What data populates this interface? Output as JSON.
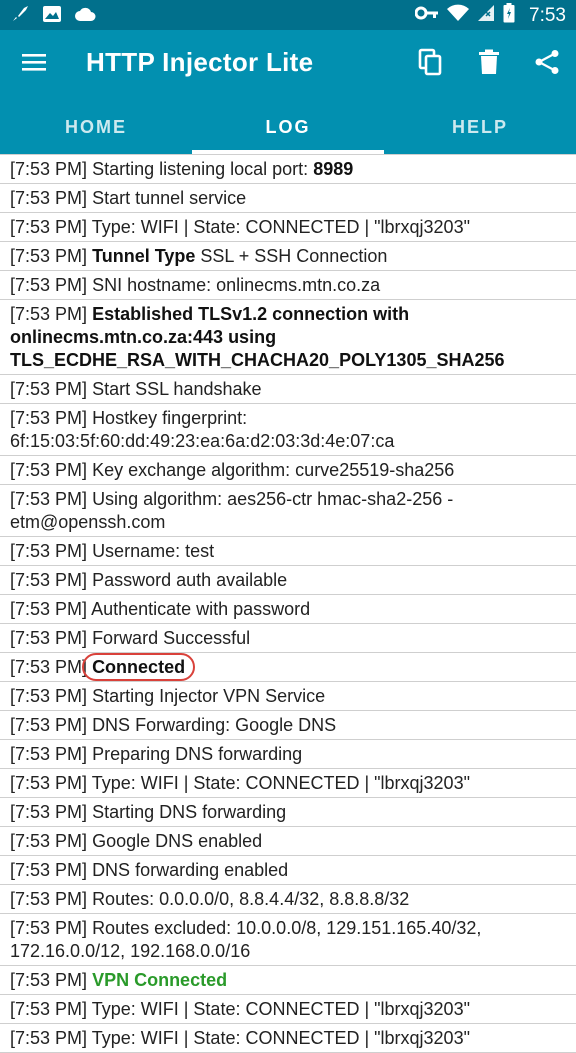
{
  "status_bar": {
    "time": "7:53"
  },
  "app_bar": {
    "title": "HTTP Injector Lite",
    "tabs": [
      "HOME",
      "LOG",
      "HELP"
    ],
    "active_tab": "LOG"
  },
  "log": [
    {
      "ts": "[7:53 PM]",
      "pre": "Starting listening local port:",
      "bold": "8989",
      "post": ""
    },
    {
      "ts": "[7:53 PM]",
      "pre": "Start tunnel service",
      "bold": "",
      "post": ""
    },
    {
      "ts": "[7:53 PM]",
      "pre": "Type: WIFI | State: CONNECTED | \"lbrxqj3203\"",
      "bold": "",
      "post": ""
    },
    {
      "ts": "[7:53 PM]",
      "pre": "",
      "bold": "Tunnel Type",
      "post": " SSL + SSH Connection"
    },
    {
      "ts": "[7:53 PM]",
      "pre": "SNI hostname: onlinecms.mtn.co.za",
      "bold": "",
      "post": ""
    },
    {
      "ts": "[7:53 PM]",
      "pre": "",
      "bold": "Established TLSv1.2 connection with onlinecms.mtn.co.za:443 using TLS_ECDHE_RSA_WITH_CHACHA20_POLY1305_SHA256",
      "post": ""
    },
    {
      "ts": "[7:53 PM]",
      "pre": "Start SSL handshake",
      "bold": "",
      "post": ""
    },
    {
      "ts": "[7:53 PM]",
      "pre": "Hostkey fingerprint: 6f:15:03:5f:60:dd:49:23:ea:6a:d2:03:3d:4e:07:ca",
      "bold": "",
      "post": ""
    },
    {
      "ts": "[7:53 PM]",
      "pre": "Key exchange algorithm: curve25519-sha256",
      "bold": "",
      "post": ""
    },
    {
      "ts": "[7:53 PM]",
      "pre": "Using algorithm: aes256-ctr hmac-sha2-256 -etm@openssh.com",
      "bold": "",
      "post": ""
    },
    {
      "ts": "[7:53 PM]",
      "pre": "Username: test",
      "bold": "",
      "post": ""
    },
    {
      "ts": "[7:53 PM]",
      "pre": "Password auth available",
      "bold": "",
      "post": ""
    },
    {
      "ts": "[7:53 PM]",
      "pre": "Authenticate with password",
      "bold": "",
      "post": ""
    },
    {
      "ts": "[7:53 PM]",
      "pre": "Forward Successful",
      "bold": "",
      "post": ""
    },
    {
      "ts": "[7:53 PM]",
      "pre": "",
      "bold": "Connected",
      "post": "",
      "circled": true
    },
    {
      "ts": "[7:53 PM]",
      "pre": "Starting Injector VPN Service",
      "bold": "",
      "post": ""
    },
    {
      "ts": "[7:53 PM]",
      "pre": "DNS Forwarding: Google DNS",
      "bold": "",
      "post": ""
    },
    {
      "ts": "[7:53 PM]",
      "pre": "Preparing DNS forwarding",
      "bold": "",
      "post": ""
    },
    {
      "ts": "[7:53 PM]",
      "pre": "Type: WIFI | State: CONNECTED | \"lbrxqj3203\"",
      "bold": "",
      "post": ""
    },
    {
      "ts": "[7:53 PM]",
      "pre": "Starting DNS forwarding",
      "bold": "",
      "post": ""
    },
    {
      "ts": "[7:53 PM]",
      "pre": "Google DNS enabled",
      "bold": "",
      "post": ""
    },
    {
      "ts": "[7:53 PM]",
      "pre": "DNS forwarding enabled",
      "bold": "",
      "post": ""
    },
    {
      "ts": "[7:53 PM]",
      "pre": "Routes: 0.0.0.0/0, 8.8.4.4/32, 8.8.8.8/32",
      "bold": "",
      "post": ""
    },
    {
      "ts": "[7:53 PM]",
      "pre": "Routes excluded: 10.0.0.0/8, 129.151.165.40/32, 172.16.0.0/12, 192.168.0.0/16",
      "bold": "",
      "post": ""
    },
    {
      "ts": "[7:53 PM]",
      "pre": "",
      "bold": "",
      "post": "",
      "green": "VPN Connected"
    },
    {
      "ts": "[7:53 PM]",
      "pre": "Type: WIFI | State: CONNECTED | \"lbrxqj3203\"",
      "bold": "",
      "post": ""
    },
    {
      "ts": "[7:53 PM]",
      "pre": "Type: WIFI | State: CONNECTED | \"lbrxqj3203\"",
      "bold": "",
      "post": ""
    }
  ]
}
